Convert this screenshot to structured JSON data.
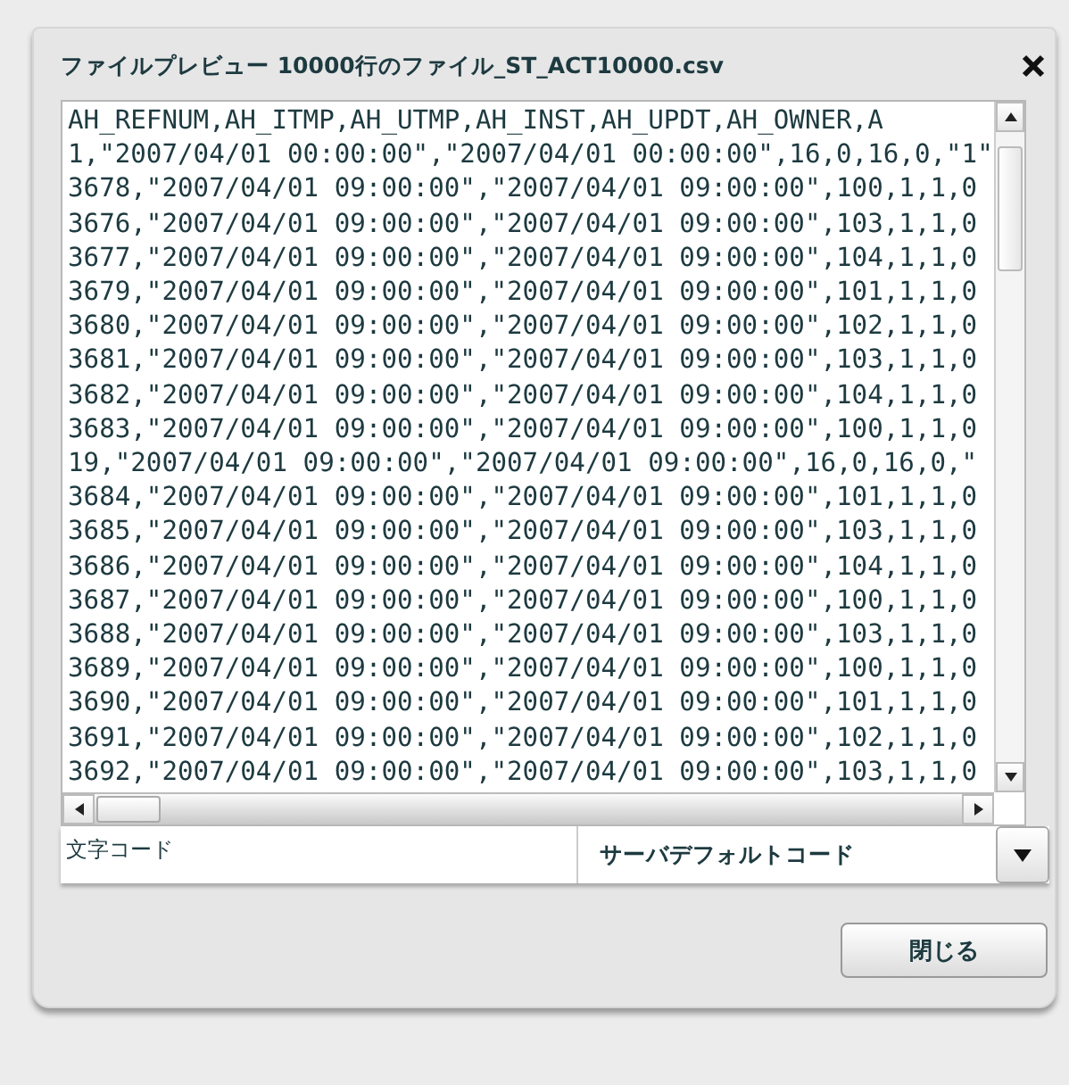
{
  "window": {
    "title": "ファイルプレビュー 10000行のファイル_ST_ACT10000.csv"
  },
  "preview": {
    "lines": [
      "AH_REFNUM,AH_ITMP,AH_UTMP,AH_INST,AH_UPDT,AH_OWNER,A",
      "1,\"2007/04/01 00:00:00\",\"2007/04/01 00:00:00\",16,0,16,0,\"1\"",
      "3678,\"2007/04/01 09:00:00\",\"2007/04/01 09:00:00\",100,1,1,0",
      "3676,\"2007/04/01 09:00:00\",\"2007/04/01 09:00:00\",103,1,1,0",
      "3677,\"2007/04/01 09:00:00\",\"2007/04/01 09:00:00\",104,1,1,0",
      "3679,\"2007/04/01 09:00:00\",\"2007/04/01 09:00:00\",101,1,1,0",
      "3680,\"2007/04/01 09:00:00\",\"2007/04/01 09:00:00\",102,1,1,0",
      "3681,\"2007/04/01 09:00:00\",\"2007/04/01 09:00:00\",103,1,1,0",
      "3682,\"2007/04/01 09:00:00\",\"2007/04/01 09:00:00\",104,1,1,0",
      "3683,\"2007/04/01 09:00:00\",\"2007/04/01 09:00:00\",100,1,1,0",
      "19,\"2007/04/01 09:00:00\",\"2007/04/01 09:00:00\",16,0,16,0,\"",
      "3684,\"2007/04/01 09:00:00\",\"2007/04/01 09:00:00\",101,1,1,0",
      "3685,\"2007/04/01 09:00:00\",\"2007/04/01 09:00:00\",103,1,1,0",
      "3686,\"2007/04/01 09:00:00\",\"2007/04/01 09:00:00\",104,1,1,0",
      "3687,\"2007/04/01 09:00:00\",\"2007/04/01 09:00:00\",100,1,1,0",
      "3688,\"2007/04/01 09:00:00\",\"2007/04/01 09:00:00\",103,1,1,0",
      "3689,\"2007/04/01 09:00:00\",\"2007/04/01 09:00:00\",100,1,1,0",
      "3690,\"2007/04/01 09:00:00\",\"2007/04/01 09:00:00\",101,1,1,0",
      "3691,\"2007/04/01 09:00:00\",\"2007/04/01 09:00:00\",102,1,1,0",
      "3692,\"2007/04/01 09:00:00\",\"2007/04/01 09:00:00\",103,1,1,0"
    ]
  },
  "encoding": {
    "label": "文字コード",
    "value": "サーバデフォルトコード"
  },
  "buttons": [
    "閉じる"
  ]
}
